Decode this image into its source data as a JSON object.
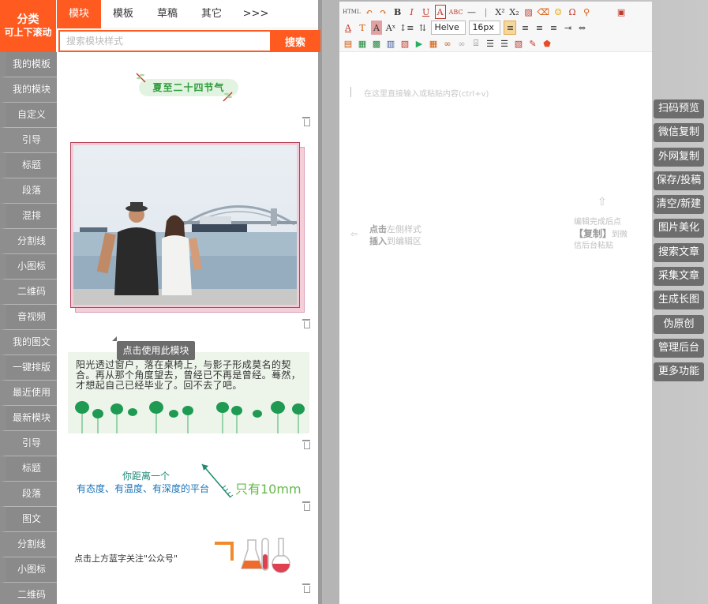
{
  "sidebar": {
    "header_line1": "分类",
    "header_line2": "可上下滚动",
    "items": [
      {
        "label": "我的模板"
      },
      {
        "label": "我的模块"
      },
      {
        "label": "自定义"
      },
      {
        "label": "引导"
      },
      {
        "label": "标题"
      },
      {
        "label": "段落"
      },
      {
        "label": "混排"
      },
      {
        "label": "分割线"
      },
      {
        "label": "小图标"
      },
      {
        "label": "二维码"
      },
      {
        "label": "音视频"
      },
      {
        "label": "我的图文"
      },
      {
        "label": "一键排版"
      },
      {
        "label": "最近使用"
      },
      {
        "label": "最新模块"
      },
      {
        "label": "引导"
      },
      {
        "label": "标题"
      },
      {
        "label": "段落"
      },
      {
        "label": "图文"
      },
      {
        "label": "分割线"
      },
      {
        "label": "小图标"
      },
      {
        "label": "二维码"
      }
    ]
  },
  "tabs": [
    {
      "label": "模块"
    },
    {
      "label": "模板"
    },
    {
      "label": "草稿"
    },
    {
      "label": "其它"
    },
    {
      "label": ">>>"
    }
  ],
  "search": {
    "placeholder": "搜索模块样式",
    "button": "搜索"
  },
  "modules": {
    "solstice_title": "夏至二十四节气",
    "tooltip": "点击使用此模块",
    "sunlight_text": "阳光透过窗户，落在桌椅上，与影子形成莫名的契合。再从那个角度望去，曾经已不再是曾经。蓦然，才想起自己已经毕业了。回不去了吧。",
    "distance_line1": "你距离一个",
    "distance_line2": "有态度、有温度、有深度的平台",
    "distance_big": "只有10mm",
    "follow_text": "点击上方蓝字关注\"公众号\""
  },
  "editor": {
    "font_family": "Helve",
    "font_size": "16px",
    "placeholder": "在这里直接输入或粘贴内容(ctrl+v)",
    "hint_left_strong1": "点击",
    "hint_left_text1": "左侧样式",
    "hint_left_strong2": "插入",
    "hint_left_text2": "到编辑区",
    "hint_right_text1": "编辑完成后点",
    "hint_right_strong": "【复制】",
    "hint_right_text2": "到微信后台粘贴"
  },
  "actions": [
    {
      "label": "扫码预览"
    },
    {
      "label": "微信复制"
    },
    {
      "label": "外网复制"
    },
    {
      "label": "保存/投稿"
    },
    {
      "label": "清空/新建"
    },
    {
      "label": "图片美化"
    },
    {
      "label": "搜索文章"
    },
    {
      "label": "采集文章"
    },
    {
      "label": "生成长图"
    },
    {
      "label": "伪原创"
    },
    {
      "label": "管理后台"
    },
    {
      "label": "更多功能"
    }
  ],
  "colors": {
    "accent": "#ff5a1f",
    "green": "#2e9c3d",
    "action_bg": "#6d6d6d"
  }
}
